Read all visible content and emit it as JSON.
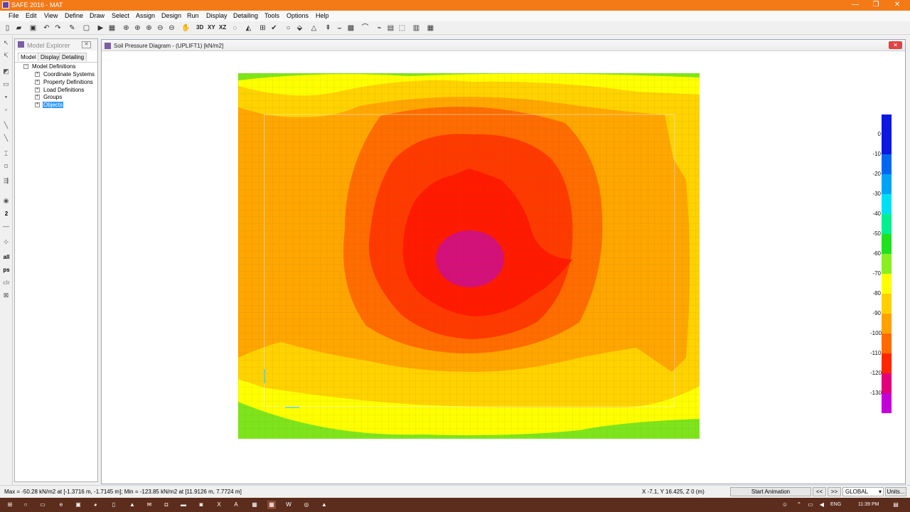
{
  "app": {
    "title": "SAFE 2016 - MAT"
  },
  "window_controls": {
    "minimize": "—",
    "restore": "❐",
    "close": "✕"
  },
  "menu": [
    "File",
    "Edit",
    "View",
    "Define",
    "Draw",
    "Select",
    "Assign",
    "Design",
    "Run",
    "Display",
    "Detailing",
    "Tools",
    "Options",
    "Help"
  ],
  "toolbar": {
    "view_3d": "3D",
    "view_xy": "XY",
    "view_xz": "XZ"
  },
  "left_toolbar": {
    "all": "all",
    "ps": "ps",
    "clr": "clr",
    "dim": "2"
  },
  "model_explorer": {
    "title": "Model Explorer",
    "tabs": [
      "Model",
      "Display",
      "Detailing"
    ],
    "root": "Model Definitions",
    "items": [
      "Coordinate Systems",
      "Property Definitions",
      "Load Definitions",
      "Groups",
      "Objects"
    ]
  },
  "document": {
    "title": "Soil Pressure Diagram - (UPLIFT1)  [kN/m2]"
  },
  "legend": {
    "labels": [
      "0",
      "-10",
      "-20",
      "-30",
      "-40",
      "-50",
      "-60",
      "-70",
      "-80",
      "-90",
      "-100",
      "-110",
      "-120",
      "-130"
    ],
    "colors": [
      "#0a18e0",
      "#0068f0",
      "#00a4f5",
      "#00e0f5",
      "#00f090",
      "#20e020",
      "#88ef22",
      "#ffff00",
      "#ffd000",
      "#ffa200",
      "#ff6b00",
      "#ff2600",
      "#e2007a",
      "#c400d8"
    ]
  },
  "contour_colors": {
    "green": "#7ee51c",
    "yellow": "#ffff00",
    "light_orange": "#ffd200",
    "orange": "#ffa600",
    "dark_orange": "#ff6c00",
    "red_orange": "#ff3a00",
    "red": "#ff1a00",
    "magenta": "#d4107a"
  },
  "status": {
    "max_min": "Max = -50.28 kN/m2 at [-1.3716 m, -1.7145 m];  Min = -123.85 kN/m2 at [11.9126 m, 7.7724 m]",
    "coords": "X -7.1,  Y 16.425,  Z 0  (m)",
    "start_animation": "Start Animation",
    "prev": "<<",
    "next": ">>",
    "coord_system": "GLOBAL",
    "units": "Units..."
  },
  "taskbar": {
    "language": "ENG",
    "time": "11:39 PM"
  }
}
